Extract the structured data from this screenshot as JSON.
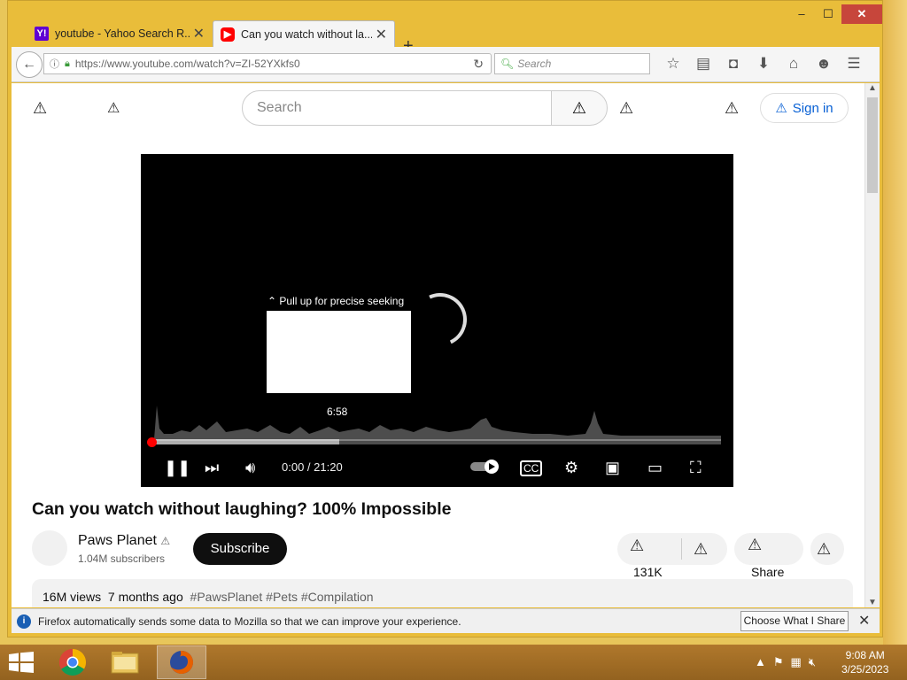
{
  "browser": {
    "tabs": [
      {
        "title": "youtube - Yahoo Search R...",
        "favicon": "yahoo-icon",
        "active": false
      },
      {
        "title": "Can you watch without la...",
        "favicon": "youtube-icon",
        "active": true
      }
    ],
    "url": "https://www.youtube.com/watch?v=ZI-52YXkfs0",
    "search_placeholder": "Search",
    "window_buttons": {
      "minimize": "–",
      "maximize": "☐",
      "close": "✕"
    }
  },
  "youtube": {
    "search_placeholder": "Search",
    "sign_in_label": "Sign in",
    "player": {
      "seek_hint": "Pull up for precise seeking",
      "preview_time": "6:58",
      "time_display": "0:00 / 21:20",
      "current_seconds": 0,
      "duration_seconds": 1280,
      "buffered_fraction": 0.33
    },
    "video": {
      "title": "Can you watch without laughing? 100% Impossible",
      "channel": "Paws Planet",
      "subscribers": "1.04M subscribers",
      "subscribe_label": "Subscribe",
      "likes": "131K",
      "share_label": "Share",
      "views": "16M views",
      "age": "7 months ago",
      "hashtags": "#PawsPlanet #Pets #Compilation"
    }
  },
  "infobar": {
    "message": "Firefox automatically sends some data to Mozilla so that we can improve your experience.",
    "button_label": "Choose What I Share"
  },
  "taskbar": {
    "time": "9:08 AM",
    "date": "3/25/2023"
  },
  "colors": {
    "accent_red": "#ff0000",
    "link_blue": "#065fd4",
    "firefox_frame": "#e9bd3a"
  }
}
